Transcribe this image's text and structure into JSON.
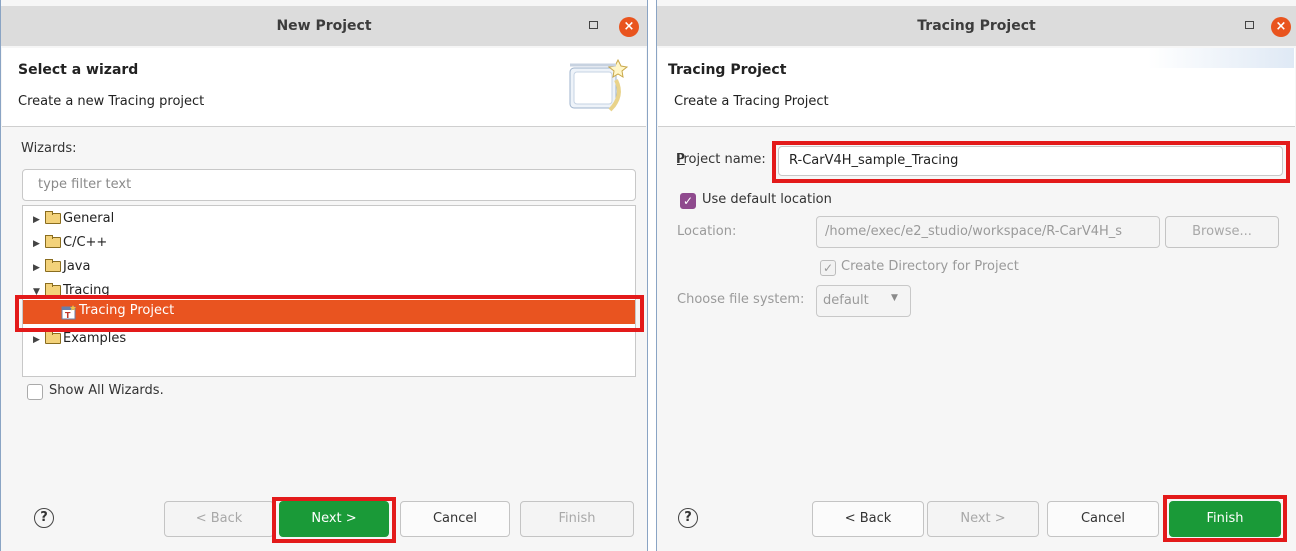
{
  "left": {
    "title": "New Project",
    "banner_heading": "Select a wizard",
    "banner_desc": "Create a new Tracing project",
    "wizards_label": "Wizards:",
    "filter_placeholder": "type filter text",
    "tree": [
      {
        "label": "General",
        "expanded": false,
        "icon": "folder-icon"
      },
      {
        "label": "C/C++",
        "expanded": false,
        "icon": "folder-icon"
      },
      {
        "label": "Java",
        "expanded": false,
        "icon": "folder-icon"
      },
      {
        "label": "Tracing",
        "expanded": true,
        "icon": "folder-icon"
      },
      {
        "label": "Tracing Project",
        "selected": true,
        "icon": "tracing-project-icon"
      },
      {
        "label": "Examples",
        "expanded": false,
        "icon": "folder-icon"
      }
    ],
    "show_all_label": "Show All Wizards.",
    "buttons": {
      "back": "< Back",
      "next": "Next >",
      "cancel": "Cancel",
      "finish": "Finish"
    }
  },
  "right": {
    "title": "Tracing Project",
    "banner_heading": "Tracing Project",
    "banner_desc": "Create a Tracing Project",
    "project_name_label": "Project name:",
    "project_name_value": "R-CarV4H_sample_Tracing",
    "use_default_label": "Use default location",
    "location_label": "Location:",
    "location_value": "/home/exec/e2_studio/workspace/R-CarV4H_s",
    "browse_label": "Browse...",
    "create_dir_label": "Create Directory for Project",
    "file_system_label": "Choose file system:",
    "file_system_value": "default",
    "buttons": {
      "back": "< Back",
      "next": "Next >",
      "cancel": "Cancel",
      "finish": "Finish"
    }
  },
  "colors": {
    "selection": "#e95420",
    "highlight_frame": "#e31a1a",
    "primary_button": "#1a9a38",
    "checkbox": "#8f4a8e"
  }
}
